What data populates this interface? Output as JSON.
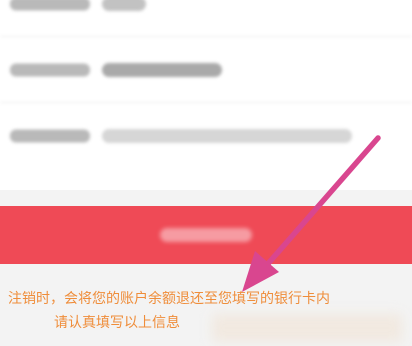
{
  "notice": {
    "line1": "注销时，会将您的账户余额退还至您填写的银行卡内",
    "line2": "请认真填写以上信息"
  },
  "colors": {
    "button": "#ef4a56",
    "notice_text": "#ef8d3a",
    "annotation_arrow": "#d9468f"
  },
  "icons": {
    "annotation": "arrow-pointing-down-left"
  }
}
